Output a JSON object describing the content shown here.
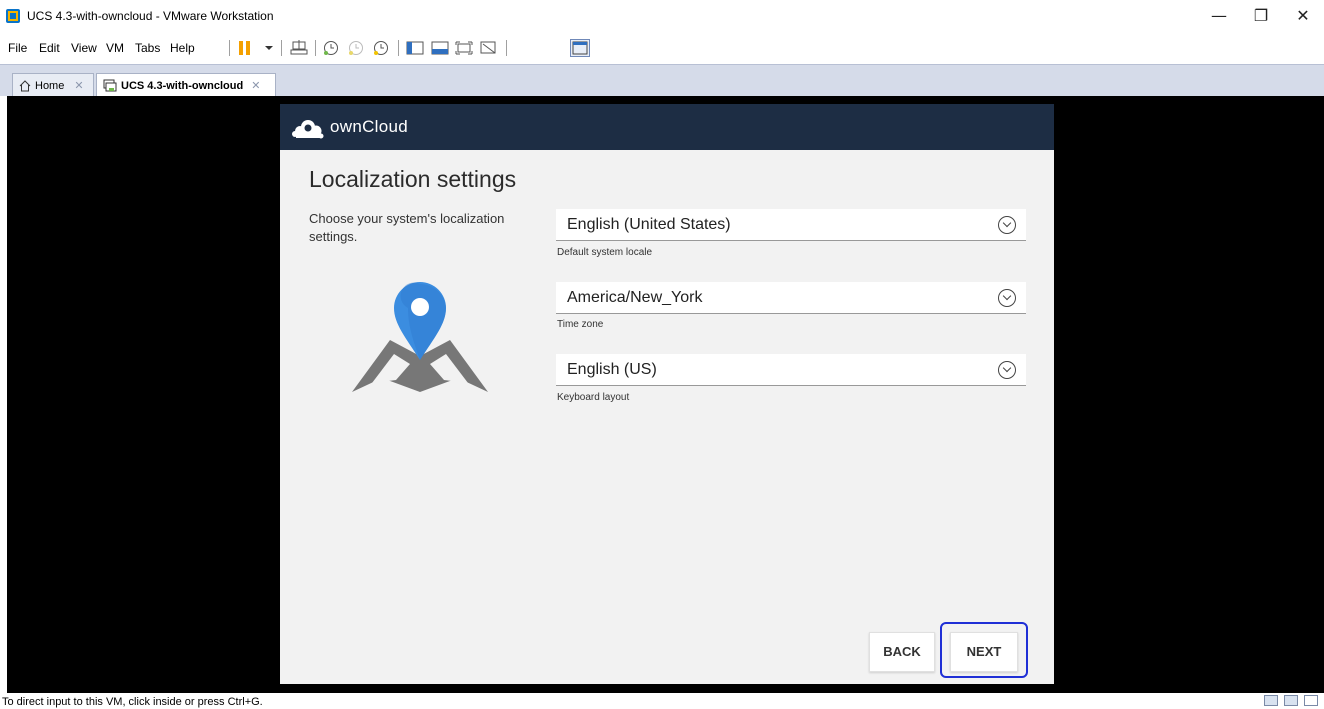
{
  "window": {
    "title": "UCS 4.3-with-owncloud - VMware Workstation",
    "minimize_glyph": "—",
    "restore_glyph": "❐",
    "close_glyph": "✕"
  },
  "menu": {
    "items": [
      "File",
      "Edit",
      "View",
      "VM",
      "Tabs",
      "Help"
    ]
  },
  "tabs": [
    {
      "label": "Home",
      "close": "✕"
    },
    {
      "label": "UCS 4.3-with-owncloud",
      "close": "✕"
    }
  ],
  "owncloud": {
    "brand": "ownCloud",
    "title": "Localization settings",
    "description": "Choose your system's localization settings.",
    "locale": {
      "value": "English (United States)",
      "caption": "Default system locale"
    },
    "timezone": {
      "value": "America/New_York",
      "caption": "Time zone"
    },
    "keyboard": {
      "value": "English (US)",
      "caption": "Keyboard layout"
    },
    "back_label": "BACK",
    "next_label": "NEXT"
  },
  "status": {
    "text": "To direct input to this VM, click inside or press Ctrl+G."
  },
  "colors": {
    "owncloud_header": "#1d2d44",
    "highlight": "#1f2fd6",
    "pin_blue": "#3b8de0",
    "vmware_orange": "#f4a000"
  }
}
